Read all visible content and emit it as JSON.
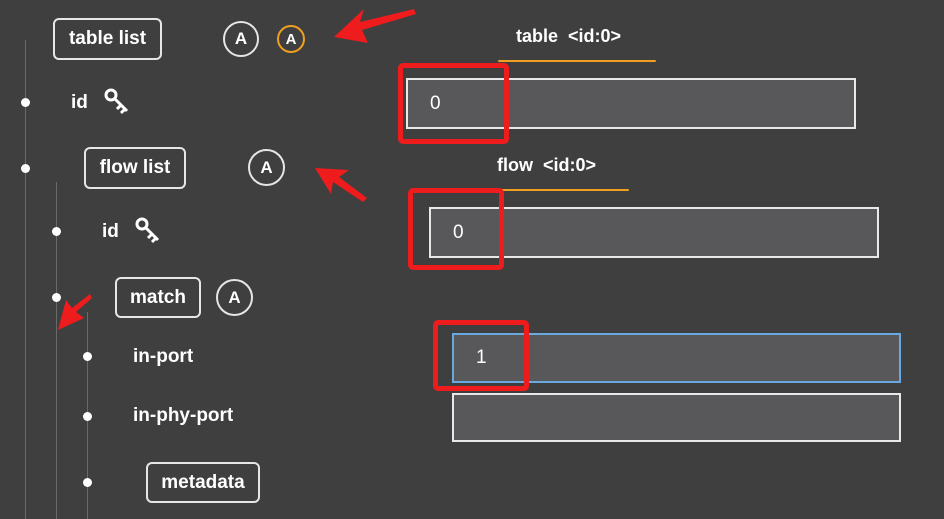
{
  "tree": {
    "table_list": {
      "label": "table list",
      "add_a": "A",
      "add_b": "A"
    },
    "table_id": {
      "label": "id"
    },
    "flow_list": {
      "label": "flow list",
      "add": "A"
    },
    "flow_id": {
      "label": "id"
    },
    "match": {
      "label": "match",
      "add": "A"
    },
    "in_port": {
      "label": "in-port"
    },
    "in_phy_port": {
      "label": "in-phy-port"
    },
    "metadata": {
      "label": "metadata"
    }
  },
  "panels": {
    "table_tab": {
      "title": "table  <id:0>"
    },
    "table_id_value": "0",
    "flow_tab": {
      "title": "flow  <id:0>"
    },
    "flow_id_value": "0",
    "in_port_value": "1",
    "in_phy_port_value": ""
  },
  "colors": {
    "background": "#3f3f40",
    "accent_orange": "#f0a020",
    "focus_blue": "#6aa8e0",
    "annotation_red": "#ee1c1c"
  },
  "icons": [
    "key-icon",
    "annotation-arrow"
  ]
}
